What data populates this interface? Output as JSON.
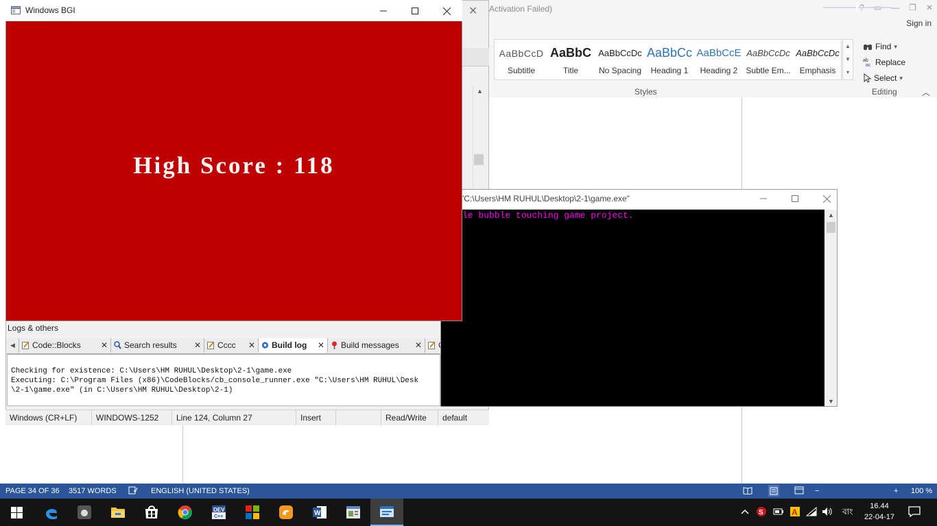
{
  "word": {
    "activation_text": "Activation Failed)",
    "sign_in": "Sign in",
    "title_controls": [
      "?",
      "▭",
      "—",
      "❐",
      "✕"
    ],
    "styles": [
      {
        "sample": "AaBbCcD",
        "label": "Subtitle"
      },
      {
        "sample": "AaBbC",
        "label": "Title"
      },
      {
        "sample": "AaBbCcDc",
        "label": "No Spacing"
      },
      {
        "sample": "AaBbCc",
        "label": "Heading 1"
      },
      {
        "sample": "AaBbCcE",
        "label": "Heading 2"
      },
      {
        "sample": "AaBbCcDc",
        "label": "Subtle Em..."
      },
      {
        "sample": "AaBbCcDc",
        "label": "Emphasis"
      }
    ],
    "styles_group_label": "Styles",
    "editing": {
      "find": "Find",
      "replace": "Replace",
      "select": "Select",
      "group_label": "Editing"
    },
    "status": {
      "page": "PAGE 34 OF 36",
      "words": "3517 WORDS",
      "language": "ENGLISH (UNITED STATES)",
      "zoom": "100 %",
      "zoom_minus": "−",
      "zoom_plus": "+"
    },
    "colors": {
      "status_bar": "#2b579a",
      "heading_blue": "#2e74b5"
    }
  },
  "codeblocks": {
    "logs_title": "Logs & others",
    "tabs": [
      {
        "label": "Code::Blocks",
        "active": false
      },
      {
        "label": "Search results",
        "active": false
      },
      {
        "label": "Cccc",
        "active": false
      },
      {
        "label": "Build log",
        "active": true
      },
      {
        "label": "Build messages",
        "active": false
      },
      {
        "label": "C",
        "active": false
      }
    ],
    "log_lines": [
      "Checking for existence: C:\\Users\\HM RUHUL\\Desktop\\2-1\\game.exe",
      "Executing: C:\\Program Files (x86)\\CodeBlocks/cb_console_runner.exe \"C:\\Users\\HM RUHUL\\Desk",
      "\\2-1\\game.exe\" (in C:\\Users\\HM RUHUL\\Desktop\\2-1)"
    ],
    "status": {
      "eol": "Windows (CR+LF)",
      "encoding": "WINDOWS-1252",
      "position": "Line 124, Column 27",
      "mode": "Insert",
      "access": "Read/Write",
      "profile": "default"
    }
  },
  "console": {
    "title": "\"C:\\Users\\HM RUHUL\\Desktop\\2-1\\game.exe\"",
    "output": "le bubble touching game project.",
    "colors": {
      "background": "#000000",
      "text": "#f500f5"
    }
  },
  "bgi": {
    "title": "Windows BGI",
    "score_text": "High Score : 118",
    "colors": {
      "background": "#c00000",
      "text": "#f5f5f5"
    }
  },
  "taskbar": {
    "apps": [
      "start-icon",
      "edge-icon",
      "apple-app-icon",
      "file-explorer-icon",
      "store-icon",
      "chrome-icon",
      "devcpp-icon",
      "codeblocks-icon",
      "uc-browser-icon",
      "word-icon",
      "document-app-icon",
      "console-app-icon"
    ],
    "language": "বাং",
    "time": "16.44",
    "date": "22-04-17"
  }
}
